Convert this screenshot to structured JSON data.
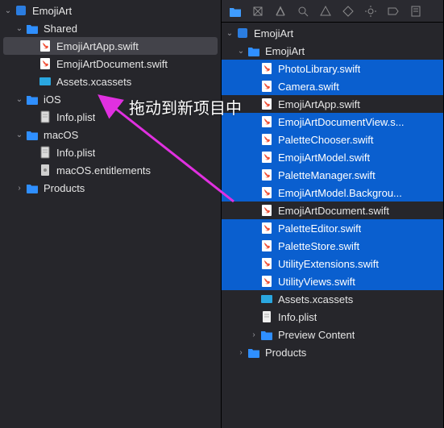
{
  "annotation_text": "拖动到新项目中",
  "left": {
    "root": "EmojiArt",
    "shared": "Shared",
    "shared_items": [
      "EmojiArtApp.swift",
      "EmojiArtDocument.swift",
      "Assets.xcassets"
    ],
    "ios": "iOS",
    "ios_items": [
      "Info.plist"
    ],
    "macos": "macOS",
    "macos_items": [
      "Info.plist",
      "macOS.entitlements"
    ],
    "products": "Products"
  },
  "right": {
    "root": "EmojiArt",
    "folder": "EmojiArt",
    "items": [
      {
        "label": "PhotoLibrary.swift",
        "type": "swift",
        "hl": true
      },
      {
        "label": "Camera.swift",
        "type": "swift",
        "hl": true
      },
      {
        "label": "EmojiArtApp.swift",
        "type": "swift",
        "hl": false
      },
      {
        "label": "EmojiArtDocumentView.s...",
        "type": "swift",
        "hl": true
      },
      {
        "label": "PaletteChooser.swift",
        "type": "swift",
        "hl": true
      },
      {
        "label": "EmojiArtModel.swift",
        "type": "swift",
        "hl": true
      },
      {
        "label": "PaletteManager.swift",
        "type": "swift",
        "hl": true
      },
      {
        "label": "EmojiArtModel.Backgrou...",
        "type": "swift",
        "hl": true
      },
      {
        "label": "EmojiArtDocument.swift",
        "type": "swift",
        "hl": false
      },
      {
        "label": "PaletteEditor.swift",
        "type": "swift",
        "hl": true
      },
      {
        "label": "PaletteStore.swift",
        "type": "swift",
        "hl": true
      },
      {
        "label": "UtilityExtensions.swift",
        "type": "swift",
        "hl": true
      },
      {
        "label": "UtilityViews.swift",
        "type": "swift",
        "hl": true
      },
      {
        "label": "Assets.xcassets",
        "type": "assets",
        "hl": false
      },
      {
        "label": "Info.plist",
        "type": "plist",
        "hl": false
      }
    ],
    "preview": "Preview Content",
    "products": "Products"
  }
}
